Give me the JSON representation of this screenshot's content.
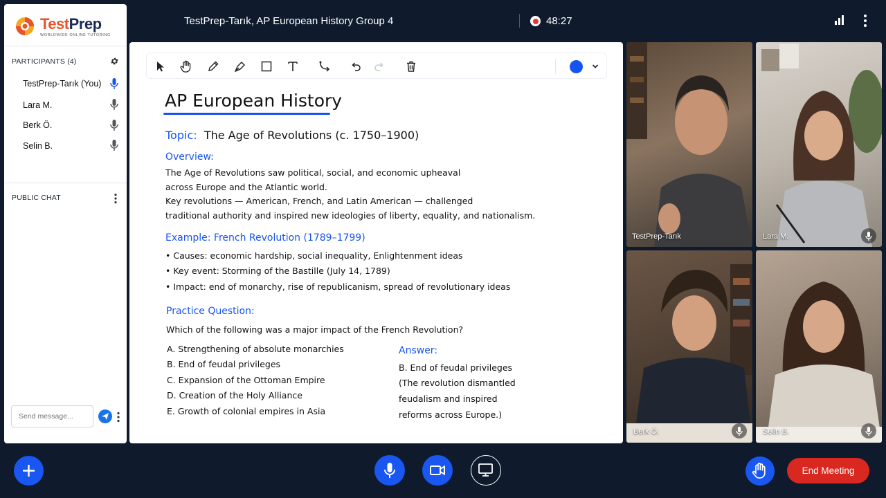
{
  "header": {
    "meeting_title": "TestPrep-Tarık, AP European History Group 4",
    "recording_time": "48:27"
  },
  "brand": {
    "name_part1": "Test",
    "name_part2": "Prep",
    "tagline": "WORLDWIDE  ONLINE  TUTORING"
  },
  "participants": {
    "heading": "PARTICIPANTS (4)",
    "items": [
      {
        "name": "TestPrep-Tarık (You)",
        "mic": "active"
      },
      {
        "name": "Lara M.",
        "mic": "muted"
      },
      {
        "name": "Berk Ö.",
        "mic": "muted"
      },
      {
        "name": "Selin B.",
        "mic": "muted"
      }
    ]
  },
  "chat": {
    "heading": "PUBLIC CHAT",
    "placeholder": "Send message..."
  },
  "toolbar": {
    "tools": [
      "select-icon",
      "hand-icon",
      "pencil-icon",
      "pen-icon",
      "rectangle-icon",
      "text-icon",
      "connector-icon",
      "undo-icon",
      "redo-icon",
      "trash-icon"
    ],
    "color": "#1554f0"
  },
  "board": {
    "title": "AP  European  History",
    "topic_label": "Topic:",
    "topic_text": "The  Age  of  Revolutions  (c. 1750–1900)",
    "overview_label": "Overview:",
    "overview_lines": [
      "The  Age  of  Revolutions  saw  political,  social,  and  economic  upheaval",
      "across  Europe  and  the  Atlantic  world.",
      "Key  revolutions — American,  French,  and  Latin  American — challenged",
      "traditional  authority  and  inspired  new  ideologies  of  liberty,  equality,  and  nationalism."
    ],
    "example_label": "Example:  French  Revolution  (1789–1799)",
    "example_bullets": [
      "•  Causes:  economic  hardship,  social  inequality,  Enlightenment  ideas",
      "•  Key  event:  Storming  of  the  Bastille  (July  14,  1789)",
      "•  Impact:  end  of  monarchy,  rise  of  republicanism,  spread  of  revolutionary  ideas"
    ],
    "practice_label": "Practice  Question:",
    "question": "Which  of  the  following  was  a  major  impact  of  the  French  Revolution?",
    "options": [
      "A.   Strengthening  of  absolute  monarchies",
      "B.   End  of  feudal  privileges",
      "C.   Expansion  of  the  Ottoman  Empire",
      "D.   Creation  of  the  Holy  Alliance",
      "E.   Growth  of  colonial  empires  in  Asia"
    ],
    "answer_label": "Answer:",
    "answer_text": "B.  End  of  feudal  privileges",
    "answer_explain": [
      "(The  revolution  dismantled",
      "feudalism  and  inspired",
      "reforms  across  Europe.)"
    ]
  },
  "videos": [
    {
      "name": "TestPrep-Tarık"
    },
    {
      "name": "Lara M."
    },
    {
      "name": "Berk Ö."
    },
    {
      "name": "Selin B."
    }
  ],
  "controls": {
    "end_label": "End Meeting"
  },
  "colors": {
    "background": "#0f1b2d",
    "accent": "#1a56f0",
    "end": "#d9281f",
    "record": "#e53935"
  }
}
